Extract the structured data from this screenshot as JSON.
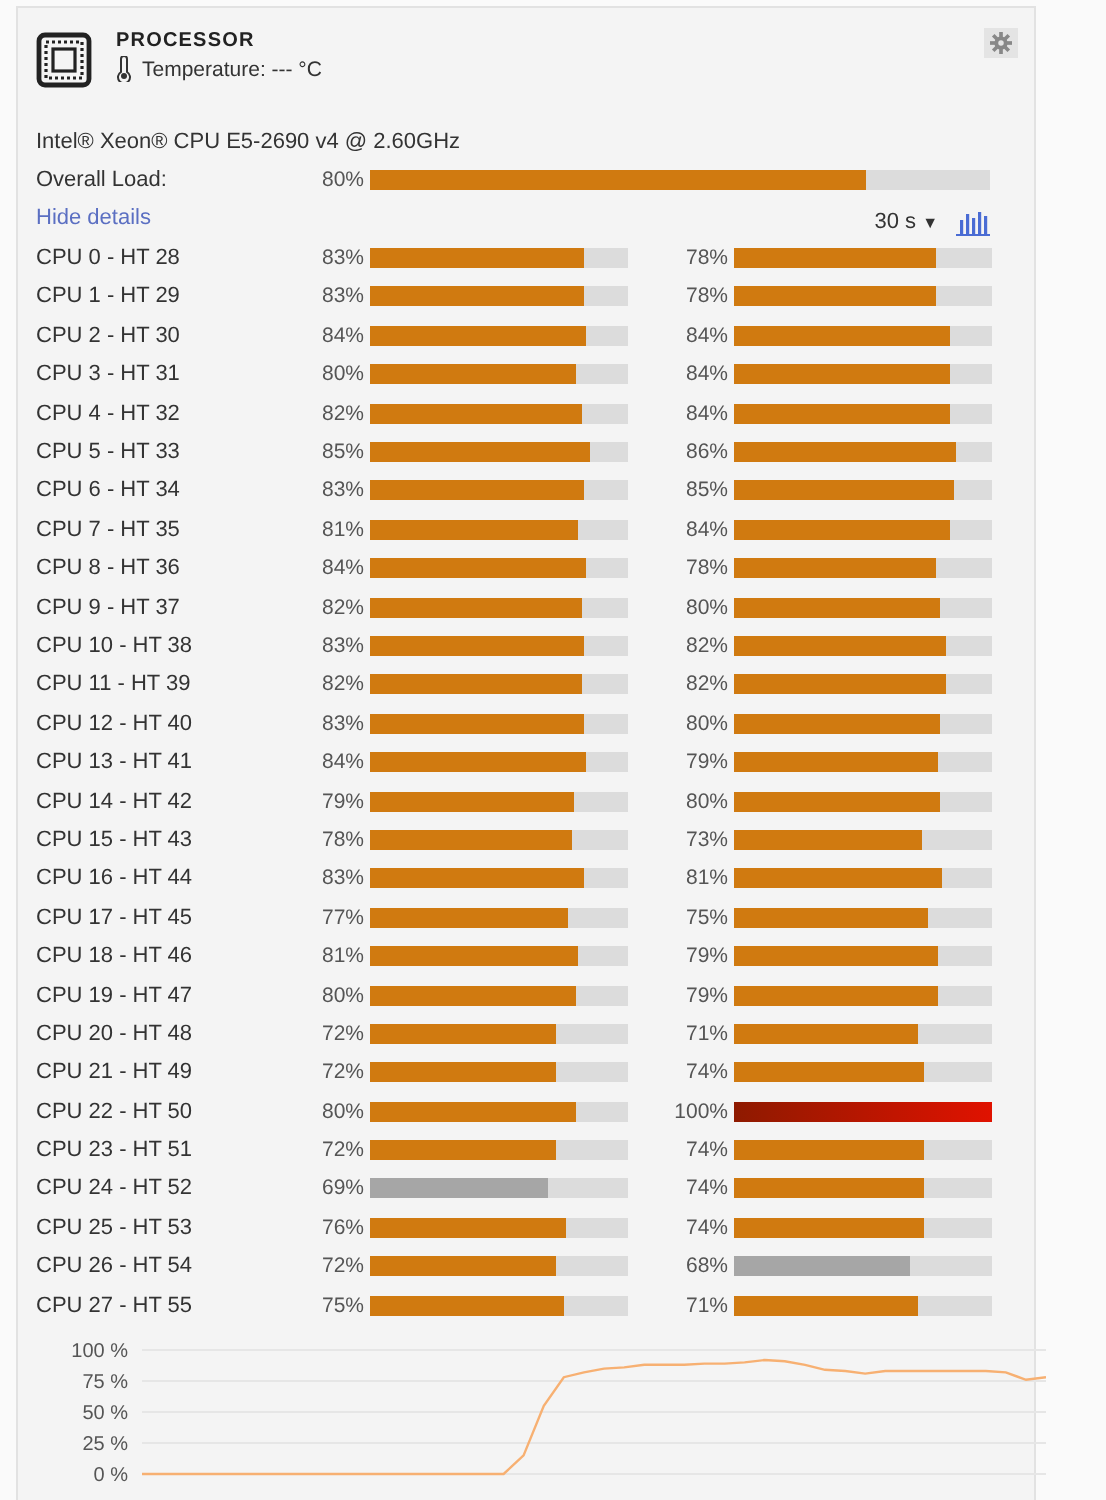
{
  "header": {
    "title": "PROCESSOR",
    "temperature": "Temperature: --- °C"
  },
  "cpu_model": "Intel® Xeon® CPU E5-2690 v4 @ 2.60GHz",
  "overall": {
    "label": "Overall Load:",
    "reading": "80%",
    "level": 0.8
  },
  "details_link": "Hide details",
  "interval": {
    "value": "30 s",
    "caret": "▼"
  },
  "cores": [
    {
      "name": "CPU 0 - HT 28",
      "left": {
        "reading": "83%",
        "level": 0.83,
        "kind": "normal"
      },
      "right": {
        "reading": "78%",
        "level": 0.78,
        "kind": "normal"
      }
    },
    {
      "name": "CPU 1 - HT 29",
      "left": {
        "reading": "83%",
        "level": 0.83,
        "kind": "normal"
      },
      "right": {
        "reading": "78%",
        "level": 0.78,
        "kind": "normal"
      }
    },
    {
      "name": "CPU 2 - HT 30",
      "left": {
        "reading": "84%",
        "level": 0.84,
        "kind": "normal"
      },
      "right": {
        "reading": "84%",
        "level": 0.84,
        "kind": "normal"
      }
    },
    {
      "name": "CPU 3 - HT 31",
      "left": {
        "reading": "80%",
        "level": 0.8,
        "kind": "normal"
      },
      "right": {
        "reading": "84%",
        "level": 0.84,
        "kind": "normal"
      }
    },
    {
      "name": "CPU 4 - HT 32",
      "left": {
        "reading": "82%",
        "level": 0.82,
        "kind": "normal"
      },
      "right": {
        "reading": "84%",
        "level": 0.84,
        "kind": "normal"
      }
    },
    {
      "name": "CPU 5 - HT 33",
      "left": {
        "reading": "85%",
        "level": 0.85,
        "kind": "normal"
      },
      "right": {
        "reading": "86%",
        "level": 0.86,
        "kind": "normal"
      }
    },
    {
      "name": "CPU 6 - HT 34",
      "left": {
        "reading": "83%",
        "level": 0.83,
        "kind": "normal"
      },
      "right": {
        "reading": "85%",
        "level": 0.85,
        "kind": "normal"
      }
    },
    {
      "name": "CPU 7 - HT 35",
      "left": {
        "reading": "81%",
        "level": 0.81,
        "kind": "normal"
      },
      "right": {
        "reading": "84%",
        "level": 0.84,
        "kind": "normal"
      }
    },
    {
      "name": "CPU 8 - HT 36",
      "left": {
        "reading": "84%",
        "level": 0.84,
        "kind": "normal"
      },
      "right": {
        "reading": "78%",
        "level": 0.78,
        "kind": "normal"
      }
    },
    {
      "name": "CPU 9 - HT 37",
      "left": {
        "reading": "82%",
        "level": 0.82,
        "kind": "normal"
      },
      "right": {
        "reading": "80%",
        "level": 0.8,
        "kind": "normal"
      }
    },
    {
      "name": "CPU 10 - HT 38",
      "left": {
        "reading": "83%",
        "level": 0.83,
        "kind": "normal"
      },
      "right": {
        "reading": "82%",
        "level": 0.82,
        "kind": "normal"
      }
    },
    {
      "name": "CPU 11 - HT 39",
      "left": {
        "reading": "82%",
        "level": 0.82,
        "kind": "normal"
      },
      "right": {
        "reading": "82%",
        "level": 0.82,
        "kind": "normal"
      }
    },
    {
      "name": "CPU 12 - HT 40",
      "left": {
        "reading": "83%",
        "level": 0.83,
        "kind": "normal"
      },
      "right": {
        "reading": "80%",
        "level": 0.8,
        "kind": "normal"
      }
    },
    {
      "name": "CPU 13 - HT 41",
      "left": {
        "reading": "84%",
        "level": 0.84,
        "kind": "normal"
      },
      "right": {
        "reading": "79%",
        "level": 0.79,
        "kind": "normal"
      }
    },
    {
      "name": "CPU 14 - HT 42",
      "left": {
        "reading": "79%",
        "level": 0.79,
        "kind": "normal"
      },
      "right": {
        "reading": "80%",
        "level": 0.8,
        "kind": "normal"
      }
    },
    {
      "name": "CPU 15 - HT 43",
      "left": {
        "reading": "78%",
        "level": 0.78,
        "kind": "normal"
      },
      "right": {
        "reading": "73%",
        "level": 0.73,
        "kind": "normal"
      }
    },
    {
      "name": "CPU 16 - HT 44",
      "left": {
        "reading": "83%",
        "level": 0.83,
        "kind": "normal"
      },
      "right": {
        "reading": "81%",
        "level": 0.81,
        "kind": "normal"
      }
    },
    {
      "name": "CPU 17 - HT 45",
      "left": {
        "reading": "77%",
        "level": 0.77,
        "kind": "normal"
      },
      "right": {
        "reading": "75%",
        "level": 0.75,
        "kind": "normal"
      }
    },
    {
      "name": "CPU 18 - HT 46",
      "left": {
        "reading": "81%",
        "level": 0.81,
        "kind": "normal"
      },
      "right": {
        "reading": "79%",
        "level": 0.79,
        "kind": "normal"
      }
    },
    {
      "name": "CPU 19 - HT 47",
      "left": {
        "reading": "80%",
        "level": 0.8,
        "kind": "normal"
      },
      "right": {
        "reading": "79%",
        "level": 0.79,
        "kind": "normal"
      }
    },
    {
      "name": "CPU 20 - HT 48",
      "left": {
        "reading": "72%",
        "level": 0.72,
        "kind": "normal"
      },
      "right": {
        "reading": "71%",
        "level": 0.71,
        "kind": "normal"
      }
    },
    {
      "name": "CPU 21 - HT 49",
      "left": {
        "reading": "72%",
        "level": 0.72,
        "kind": "normal"
      },
      "right": {
        "reading": "74%",
        "level": 0.74,
        "kind": "normal"
      }
    },
    {
      "name": "CPU 22 - HT 50",
      "left": {
        "reading": "80%",
        "level": 0.8,
        "kind": "normal"
      },
      "right": {
        "reading": "100%",
        "level": 1,
        "kind": "critical"
      }
    },
    {
      "name": "CPU 23 - HT 51",
      "left": {
        "reading": "72%",
        "level": 0.72,
        "kind": "normal"
      },
      "right": {
        "reading": "74%",
        "level": 0.74,
        "kind": "normal"
      }
    },
    {
      "name": "CPU 24 - HT 52",
      "left": {
        "reading": "69%",
        "level": 0.69,
        "kind": "low"
      },
      "right": {
        "reading": "74%",
        "level": 0.74,
        "kind": "normal"
      }
    },
    {
      "name": "CPU 25 - HT 53",
      "left": {
        "reading": "76%",
        "level": 0.76,
        "kind": "normal"
      },
      "right": {
        "reading": "74%",
        "level": 0.74,
        "kind": "normal"
      }
    },
    {
      "name": "CPU 26 - HT 54",
      "left": {
        "reading": "72%",
        "level": 0.72,
        "kind": "normal"
      },
      "right": {
        "reading": "68%",
        "level": 0.68,
        "kind": "low"
      }
    },
    {
      "name": "CPU 27 - HT 55",
      "left": {
        "reading": "75%",
        "level": 0.75,
        "kind": "normal"
      },
      "right": {
        "reading": "71%",
        "level": 0.71,
        "kind": "normal"
      }
    }
  ],
  "history": {
    "chart_data": {
      "type": "line",
      "grid": true,
      "ylim": [
        0,
        100
      ],
      "yticks": [
        {
          "value": 100,
          "label": "100 %"
        },
        {
          "value": 75,
          "label": "75 %"
        },
        {
          "value": 50,
          "label": "50 %"
        },
        {
          "value": 25,
          "label": "25 %"
        },
        {
          "value": 0,
          "label": "0 %"
        }
      ],
      "series": [
        {
          "color": "#f7b072",
          "values": [
            0,
            0,
            0,
            0,
            0,
            0,
            0,
            0,
            0,
            0,
            0,
            0,
            0,
            0,
            0,
            0,
            0,
            0,
            0,
            15,
            55,
            78,
            82,
            85,
            86,
            88,
            88,
            88,
            89,
            89,
            90,
            92,
            91,
            88,
            84,
            83,
            81,
            83,
            83,
            83,
            83,
            83,
            83,
            82,
            76,
            78
          ]
        }
      ]
    }
  }
}
